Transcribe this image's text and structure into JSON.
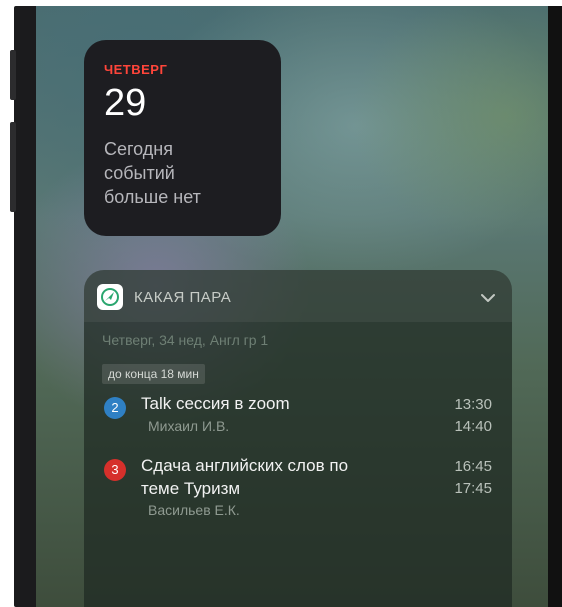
{
  "calendar_widget": {
    "day": "ЧЕТВЕРГ",
    "date": "29",
    "message_line1": "Сегодня",
    "message_line2": "событий",
    "message_line3": "больше нет"
  },
  "schedule_widget": {
    "app_name": "КАКАЯ ПАРА",
    "subtitle": "Четверг, 34 нед, Англ гр 1",
    "badge": "до конца 18 мин",
    "events": [
      {
        "number": "2",
        "title": "Talk сессия в zoom",
        "teacher": "Михаил И.В.",
        "start": "13:30",
        "end": "14:40",
        "color": "#2f80c4"
      },
      {
        "number": "3",
        "title_line1": "Сдача английских слов по",
        "title_line2": "теме Туризм",
        "teacher": "Васильев Е.К.",
        "start": "16:45",
        "end": "17:45",
        "color": "#d6302b"
      }
    ]
  },
  "colors": {
    "accent_red": "#ff453a",
    "widget_bg": "#1d1d21"
  },
  "icons": [
    "app-logo-icon",
    "chevron-down-icon"
  ]
}
